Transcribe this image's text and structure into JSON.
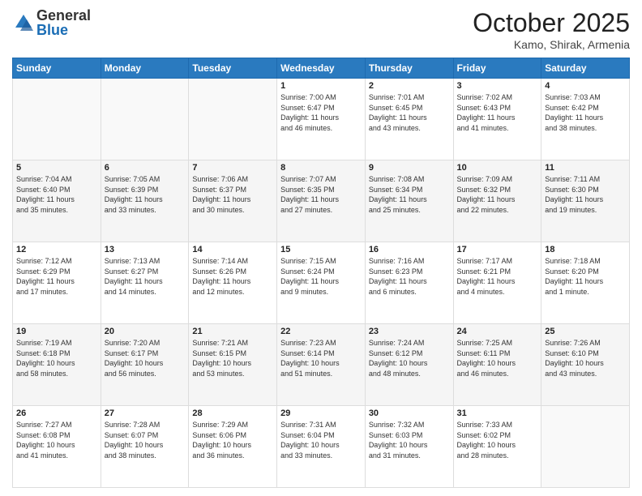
{
  "header": {
    "logo": {
      "general": "General",
      "blue": "Blue"
    },
    "title": "October 2025",
    "location": "Kamo, Shirak, Armenia"
  },
  "weekdays": [
    "Sunday",
    "Monday",
    "Tuesday",
    "Wednesday",
    "Thursday",
    "Friday",
    "Saturday"
  ],
  "weeks": [
    [
      {
        "day": "",
        "info": ""
      },
      {
        "day": "",
        "info": ""
      },
      {
        "day": "",
        "info": ""
      },
      {
        "day": "1",
        "info": "Sunrise: 7:00 AM\nSunset: 6:47 PM\nDaylight: 11 hours\nand 46 minutes."
      },
      {
        "day": "2",
        "info": "Sunrise: 7:01 AM\nSunset: 6:45 PM\nDaylight: 11 hours\nand 43 minutes."
      },
      {
        "day": "3",
        "info": "Sunrise: 7:02 AM\nSunset: 6:43 PM\nDaylight: 11 hours\nand 41 minutes."
      },
      {
        "day": "4",
        "info": "Sunrise: 7:03 AM\nSunset: 6:42 PM\nDaylight: 11 hours\nand 38 minutes."
      }
    ],
    [
      {
        "day": "5",
        "info": "Sunrise: 7:04 AM\nSunset: 6:40 PM\nDaylight: 11 hours\nand 35 minutes."
      },
      {
        "day": "6",
        "info": "Sunrise: 7:05 AM\nSunset: 6:39 PM\nDaylight: 11 hours\nand 33 minutes."
      },
      {
        "day": "7",
        "info": "Sunrise: 7:06 AM\nSunset: 6:37 PM\nDaylight: 11 hours\nand 30 minutes."
      },
      {
        "day": "8",
        "info": "Sunrise: 7:07 AM\nSunset: 6:35 PM\nDaylight: 11 hours\nand 27 minutes."
      },
      {
        "day": "9",
        "info": "Sunrise: 7:08 AM\nSunset: 6:34 PM\nDaylight: 11 hours\nand 25 minutes."
      },
      {
        "day": "10",
        "info": "Sunrise: 7:09 AM\nSunset: 6:32 PM\nDaylight: 11 hours\nand 22 minutes."
      },
      {
        "day": "11",
        "info": "Sunrise: 7:11 AM\nSunset: 6:30 PM\nDaylight: 11 hours\nand 19 minutes."
      }
    ],
    [
      {
        "day": "12",
        "info": "Sunrise: 7:12 AM\nSunset: 6:29 PM\nDaylight: 11 hours\nand 17 minutes."
      },
      {
        "day": "13",
        "info": "Sunrise: 7:13 AM\nSunset: 6:27 PM\nDaylight: 11 hours\nand 14 minutes."
      },
      {
        "day": "14",
        "info": "Sunrise: 7:14 AM\nSunset: 6:26 PM\nDaylight: 11 hours\nand 12 minutes."
      },
      {
        "day": "15",
        "info": "Sunrise: 7:15 AM\nSunset: 6:24 PM\nDaylight: 11 hours\nand 9 minutes."
      },
      {
        "day": "16",
        "info": "Sunrise: 7:16 AM\nSunset: 6:23 PM\nDaylight: 11 hours\nand 6 minutes."
      },
      {
        "day": "17",
        "info": "Sunrise: 7:17 AM\nSunset: 6:21 PM\nDaylight: 11 hours\nand 4 minutes."
      },
      {
        "day": "18",
        "info": "Sunrise: 7:18 AM\nSunset: 6:20 PM\nDaylight: 11 hours\nand 1 minute."
      }
    ],
    [
      {
        "day": "19",
        "info": "Sunrise: 7:19 AM\nSunset: 6:18 PM\nDaylight: 10 hours\nand 58 minutes."
      },
      {
        "day": "20",
        "info": "Sunrise: 7:20 AM\nSunset: 6:17 PM\nDaylight: 10 hours\nand 56 minutes."
      },
      {
        "day": "21",
        "info": "Sunrise: 7:21 AM\nSunset: 6:15 PM\nDaylight: 10 hours\nand 53 minutes."
      },
      {
        "day": "22",
        "info": "Sunrise: 7:23 AM\nSunset: 6:14 PM\nDaylight: 10 hours\nand 51 minutes."
      },
      {
        "day": "23",
        "info": "Sunrise: 7:24 AM\nSunset: 6:12 PM\nDaylight: 10 hours\nand 48 minutes."
      },
      {
        "day": "24",
        "info": "Sunrise: 7:25 AM\nSunset: 6:11 PM\nDaylight: 10 hours\nand 46 minutes."
      },
      {
        "day": "25",
        "info": "Sunrise: 7:26 AM\nSunset: 6:10 PM\nDaylight: 10 hours\nand 43 minutes."
      }
    ],
    [
      {
        "day": "26",
        "info": "Sunrise: 7:27 AM\nSunset: 6:08 PM\nDaylight: 10 hours\nand 41 minutes."
      },
      {
        "day": "27",
        "info": "Sunrise: 7:28 AM\nSunset: 6:07 PM\nDaylight: 10 hours\nand 38 minutes."
      },
      {
        "day": "28",
        "info": "Sunrise: 7:29 AM\nSunset: 6:06 PM\nDaylight: 10 hours\nand 36 minutes."
      },
      {
        "day": "29",
        "info": "Sunrise: 7:31 AM\nSunset: 6:04 PM\nDaylight: 10 hours\nand 33 minutes."
      },
      {
        "day": "30",
        "info": "Sunrise: 7:32 AM\nSunset: 6:03 PM\nDaylight: 10 hours\nand 31 minutes."
      },
      {
        "day": "31",
        "info": "Sunrise: 7:33 AM\nSunset: 6:02 PM\nDaylight: 10 hours\nand 28 minutes."
      },
      {
        "day": "",
        "info": ""
      }
    ]
  ]
}
